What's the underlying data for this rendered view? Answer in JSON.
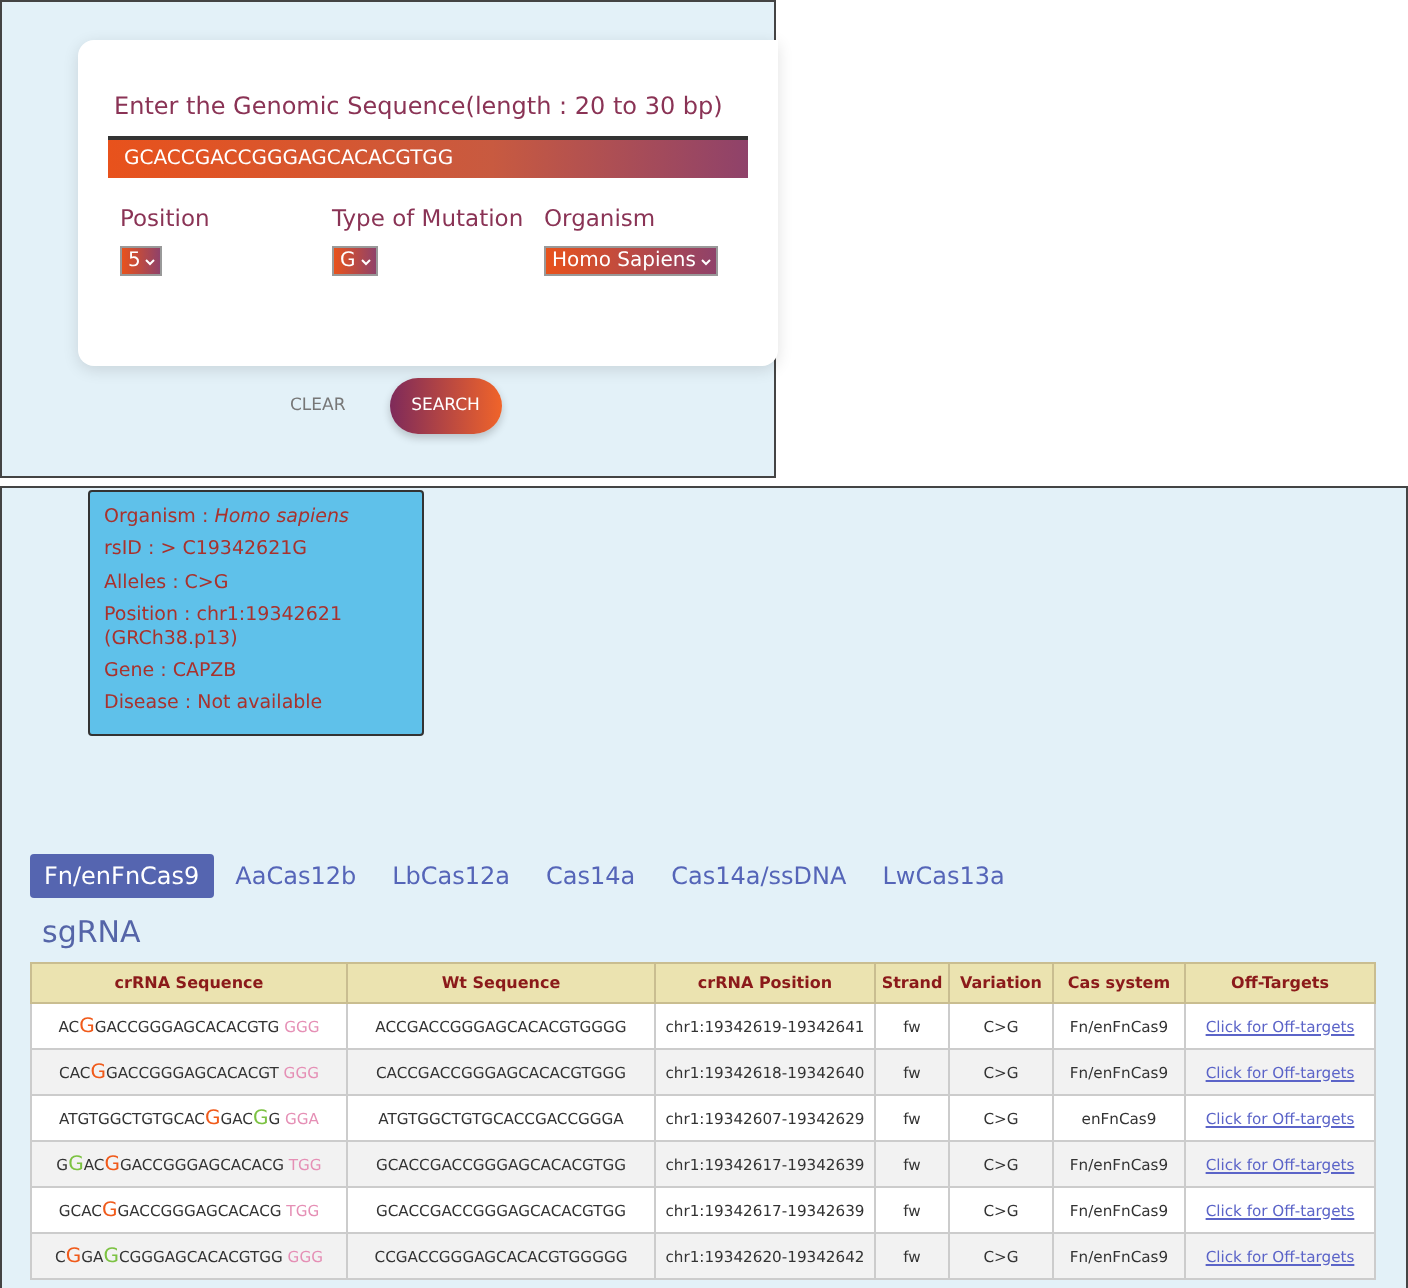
{
  "form": {
    "prompt": "Enter the Genomic Sequence(length : 20 to 30 bp)",
    "sequence": "GCACCGACCGGGAGCACACGTGG",
    "fields": [
      {
        "label": "Position",
        "value": "5"
      },
      {
        "label": "Type of Mutation",
        "value": "G"
      },
      {
        "label": "Organism",
        "value": "Homo Sapiens"
      }
    ],
    "buttons": [
      {
        "label": "CLEAR",
        "kind": "text"
      },
      {
        "label": "SEARCH",
        "kind": "primary"
      }
    ]
  },
  "info": {
    "lines": [
      {
        "label": "Organism : ",
        "value": "Homo sapiens",
        "italic": true
      },
      {
        "label": "rsID : ",
        "value": "> C19342621G",
        "italic": false
      },
      {
        "label": "Alleles : ",
        "value": "C>G",
        "italic": false
      },
      {
        "label": "Position : ",
        "value": "chr1:19342621 (GRCh38.p13)",
        "italic": false
      },
      {
        "label": "Gene : ",
        "value": "CAPZB",
        "italic": false
      },
      {
        "label": "Disease : ",
        "value": "Not available",
        "italic": false
      }
    ]
  },
  "tabs": [
    {
      "label": "Fn/enFnCas9",
      "selected": true
    },
    {
      "label": "AaCas12b",
      "selected": false
    },
    {
      "label": "LbCas12a",
      "selected": false
    },
    {
      "label": "Cas14a",
      "selected": false
    },
    {
      "label": "Cas14a/ssDNA",
      "selected": false
    },
    {
      "label": "LwCas13a",
      "selected": false
    }
  ],
  "section_title": "sgRNA",
  "table": {
    "columns": [
      "crRNA Sequence",
      "Wt Sequence",
      "crRNA Position",
      "Strand",
      "Variation",
      "Cas system",
      "Off-Targets"
    ],
    "rows": [
      {
        "crrna": [
          {
            "text": "AC",
            "kind": "base"
          },
          {
            "text": "G",
            "kind": "mutation"
          },
          {
            "text": "GACCGGGAGCACACGTG",
            "kind": "base"
          },
          {
            "text": " GGG",
            "kind": "pam"
          }
        ],
        "wt": "ACCGACCGGGAGCACACGTGGGG",
        "position": "chr1:19342619-19342641",
        "strand": "fw",
        "variation": "C>G",
        "cas_system": "Fn/enFnCas9",
        "off_targets": "Click for Off-targets"
      },
      {
        "crrna": [
          {
            "text": "CAC",
            "kind": "base"
          },
          {
            "text": "G",
            "kind": "mutation"
          },
          {
            "text": "GACCGGGAGCACACGT",
            "kind": "base"
          },
          {
            "text": " GGG",
            "kind": "pam"
          }
        ],
        "wt": "CACCGACCGGGAGCACACGTGGG",
        "position": "chr1:19342618-19342640",
        "strand": "fw",
        "variation": "C>G",
        "cas_system": "Fn/enFnCas9",
        "off_targets": "Click for Off-targets"
      },
      {
        "crrna": [
          {
            "text": "ATGTGGCTGTGCAC",
            "kind": "base"
          },
          {
            "text": "G",
            "kind": "mutation"
          },
          {
            "text": "GAC",
            "kind": "base"
          },
          {
            "text": "G",
            "kind": "mismatch"
          },
          {
            "text": "G",
            "kind": "base"
          },
          {
            "text": " GGA",
            "kind": "pam"
          }
        ],
        "wt": "ATGTGGCTGTGCACCGACCGGGA",
        "position": "chr1:19342607-19342629",
        "strand": "fw",
        "variation": "C>G",
        "cas_system": "enFnCas9",
        "off_targets": "Click for Off-targets"
      },
      {
        "crrna": [
          {
            "text": "G",
            "kind": "base"
          },
          {
            "text": "G",
            "kind": "mismatch"
          },
          {
            "text": "AC",
            "kind": "base"
          },
          {
            "text": "G",
            "kind": "mutation"
          },
          {
            "text": "GACCGGGAGCACACG",
            "kind": "base"
          },
          {
            "text": " TGG",
            "kind": "pam"
          }
        ],
        "wt": "GCACCGACCGGGAGCACACGTGG",
        "position": "chr1:19342617-19342639",
        "strand": "fw",
        "variation": "C>G",
        "cas_system": "Fn/enFnCas9",
        "off_targets": "Click for Off-targets"
      },
      {
        "crrna": [
          {
            "text": "GCAC",
            "kind": "base"
          },
          {
            "text": "G",
            "kind": "mutation"
          },
          {
            "text": "GACCGGGAGCACACG",
            "kind": "base"
          },
          {
            "text": " TGG",
            "kind": "pam"
          }
        ],
        "wt": "GCACCGACCGGGAGCACACGTGG",
        "position": "chr1:19342617-19342639",
        "strand": "fw",
        "variation": "C>G",
        "cas_system": "Fn/enFnCas9",
        "off_targets": "Click for Off-targets"
      },
      {
        "crrna": [
          {
            "text": "C",
            "kind": "base"
          },
          {
            "text": "G",
            "kind": "mutation"
          },
          {
            "text": "GA",
            "kind": "base"
          },
          {
            "text": "G",
            "kind": "mismatch"
          },
          {
            "text": "CGGGAGCACACGTGG",
            "kind": "base"
          },
          {
            "text": " GGG",
            "kind": "pam"
          }
        ],
        "wt": "CCGACCGGGAGCACACGTGGGGG",
        "position": "chr1:19342620-19342642",
        "strand": "fw",
        "variation": "C>G",
        "cas_system": "Fn/enFnCas9",
        "off_targets": "Click for Off-targets"
      }
    ]
  }
}
